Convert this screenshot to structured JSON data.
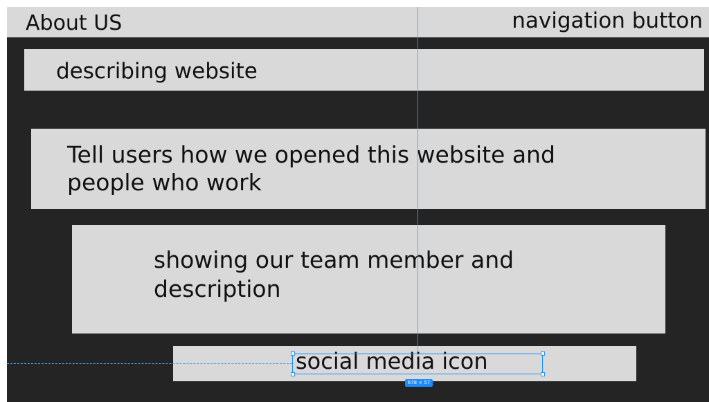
{
  "header": {
    "title": "About US",
    "nav_button": "navigation button"
  },
  "sections": [
    {
      "lines": [
        "describing website"
      ]
    },
    {
      "lines": [
        "Tell users how we opened this website  and",
        "people who work"
      ]
    },
    {
      "lines": [
        "showing our team member and",
        "description"
      ]
    }
  ],
  "footer": {
    "social_label": "social media icon"
  },
  "selection": {
    "dimension_label": "678 × 57"
  },
  "colors": {
    "canvas": "#242424",
    "block": "#d9d9d9",
    "selection": "#1a8cff"
  }
}
